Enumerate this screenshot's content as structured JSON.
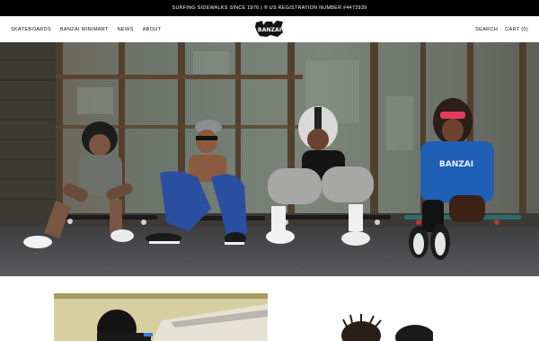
{
  "announcement": {
    "text": "SURFING SIDEWALKS SINCE 1976 | ® US REGISTRATION NUMBER #4472939"
  },
  "header": {
    "nav_left": [
      {
        "label": "SKATEBOARDS"
      },
      {
        "label": "BANZAI MINIMART"
      },
      {
        "label": "NEWS"
      },
      {
        "label": "ABOUT"
      }
    ],
    "logo_text": "BANZAI",
    "search_label": "SEARCH",
    "cart_label": "CART (0)"
  },
  "hero": {
    "shirt_print_text": "BANZAI"
  },
  "colors": {
    "announcement_bg": "#000000",
    "header_bg": "#ffffff",
    "wall_teal": "#6a7a72",
    "wall_rust": "#5a4632",
    "asphalt": "#4b4b4d",
    "blue_shirt": "#1f5fb5"
  }
}
